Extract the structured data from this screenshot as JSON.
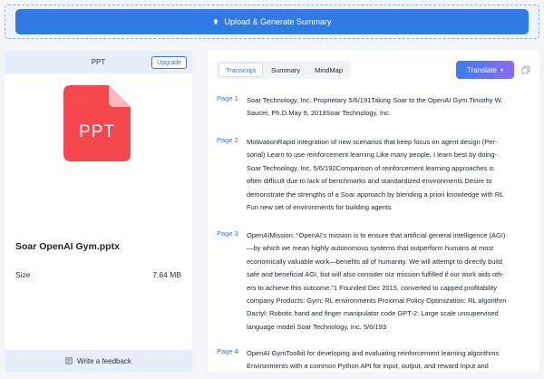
{
  "upload": {
    "label": "Upload & Generate Summary"
  },
  "left": {
    "type_label": "PPT",
    "upgrade_label": "Upgrade",
    "icon_text": "PPT",
    "file_name": "Soar OpenAI Gym.pptx",
    "size_label": "Size",
    "size_value": "7.64 MB",
    "feedback_label": "Write a feedback",
    "icon_color": "#f5474e"
  },
  "right": {
    "tabs": [
      {
        "label": "Transcript",
        "active": true
      },
      {
        "label": "Summary",
        "active": false
      },
      {
        "label": "MindMap",
        "active": false
      }
    ],
    "translate_label": "Translate",
    "pages": [
      {
        "label": "Page 1",
        "lines": [
          "Soar Technology, Inc. Proprietary   5/6/191Taking Soar to the OpenAI Gym   Timothy W.",
          "Saucer, Ph.D.May 9, 2019Soar Technology, Inc."
        ]
      },
      {
        "label": "Page 2",
        "lines": [
          "MotivationRapid integration of new scenarios that keep focus on agent design (Per-",
          "sonal) Learn to use reinforcement learning Like many people, I learn best by doing-",
          "Soar Technology, Inc.      5/6/192Comparison of reinforcement learning approaches is",
          "often difficult due to lack of benchmarks and standardized environments Desire to",
          "demonstrate the strengths of a Soar approach by  blending a priori knowledge with RL",
          "Fun new set of environments for building agents"
        ]
      },
      {
        "label": "Page 3",
        "lines": [
          "OpenAIMission: “OpenAI’s mission is to ensure that artificial general intelligence (AGI)",
          "—by which we mean highly autonomous systems that outperform humans at most",
          "economically valuable work—benefits all of humanity. We will attempt to directly build",
          "safe and beneficial AGI, but will also consider our mission fulfilled if our work aids oth-",
          "ers to achieve this outcome.”1 Founded Dec 2015, converted to capped profitability",
          "company Products: Gym: RL environments Proximal Policy Optimization: RL algorithm",
          "Dactyl: Robotic hand and finger manipulator code GPT-2: Large scale unsupervised",
          "language model Soar Technology, Inc.      5/6/193"
        ]
      },
      {
        "label": "Page 4",
        "lines": [
          "OpenAI GymToolkit for developing and evaluating reinforcement learning algorithms",
          "Environments with a common Python API for input, output, and reward Input and"
        ]
      }
    ]
  }
}
